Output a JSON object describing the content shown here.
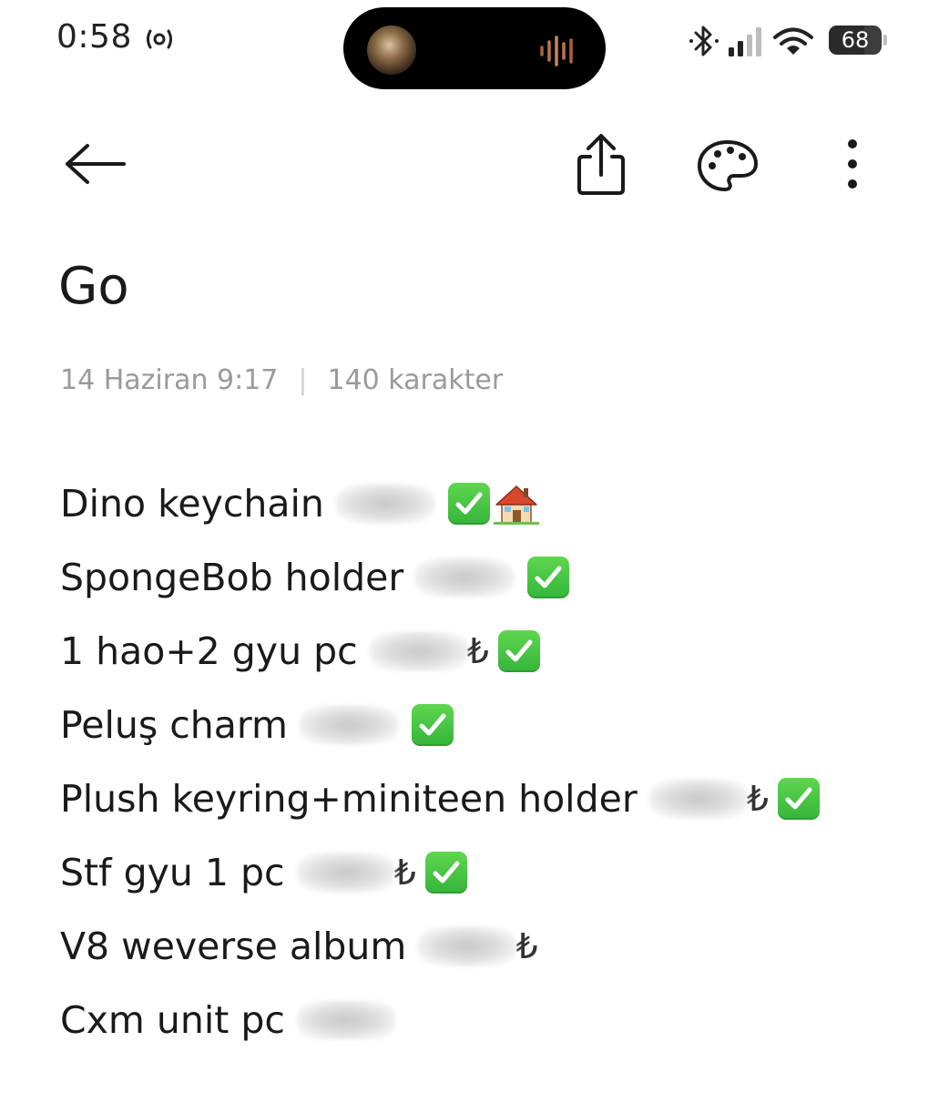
{
  "status_bar": {
    "time": "0:58",
    "battery": "68",
    "battery_fraction": 0.68
  },
  "toolbar": {
    "back_icon": "arrow-left-icon",
    "share_icon": "share-icon",
    "palette_icon": "palette-icon",
    "more_icon": "more-vertical-icon"
  },
  "note": {
    "title": "Go",
    "date": "14 Haziran 9:17",
    "separator": "|",
    "char_count": "140 karakter",
    "items": [
      {
        "text": "Dino keychain",
        "currency": "",
        "check": true,
        "house": true
      },
      {
        "text": "SpongeBob holder",
        "currency": "",
        "check": true,
        "house": false
      },
      {
        "text": "1 hao+2 gyu pc",
        "currency": "₺",
        "check": true,
        "house": false
      },
      {
        "text": "Peluş charm",
        "currency": "",
        "check": true,
        "house": false
      },
      {
        "text": "Plush keyring+miniteen holder",
        "currency": "₺",
        "check": true,
        "house": false
      },
      {
        "text": "Stf gyu 1 pc",
        "currency": "₺",
        "check": true,
        "house": false
      },
      {
        "text": "V8 weverse album",
        "currency": "₺",
        "check": false,
        "house": false
      },
      {
        "text": "Cxm unit pc",
        "currency": "",
        "check": false,
        "house": false
      }
    ]
  }
}
